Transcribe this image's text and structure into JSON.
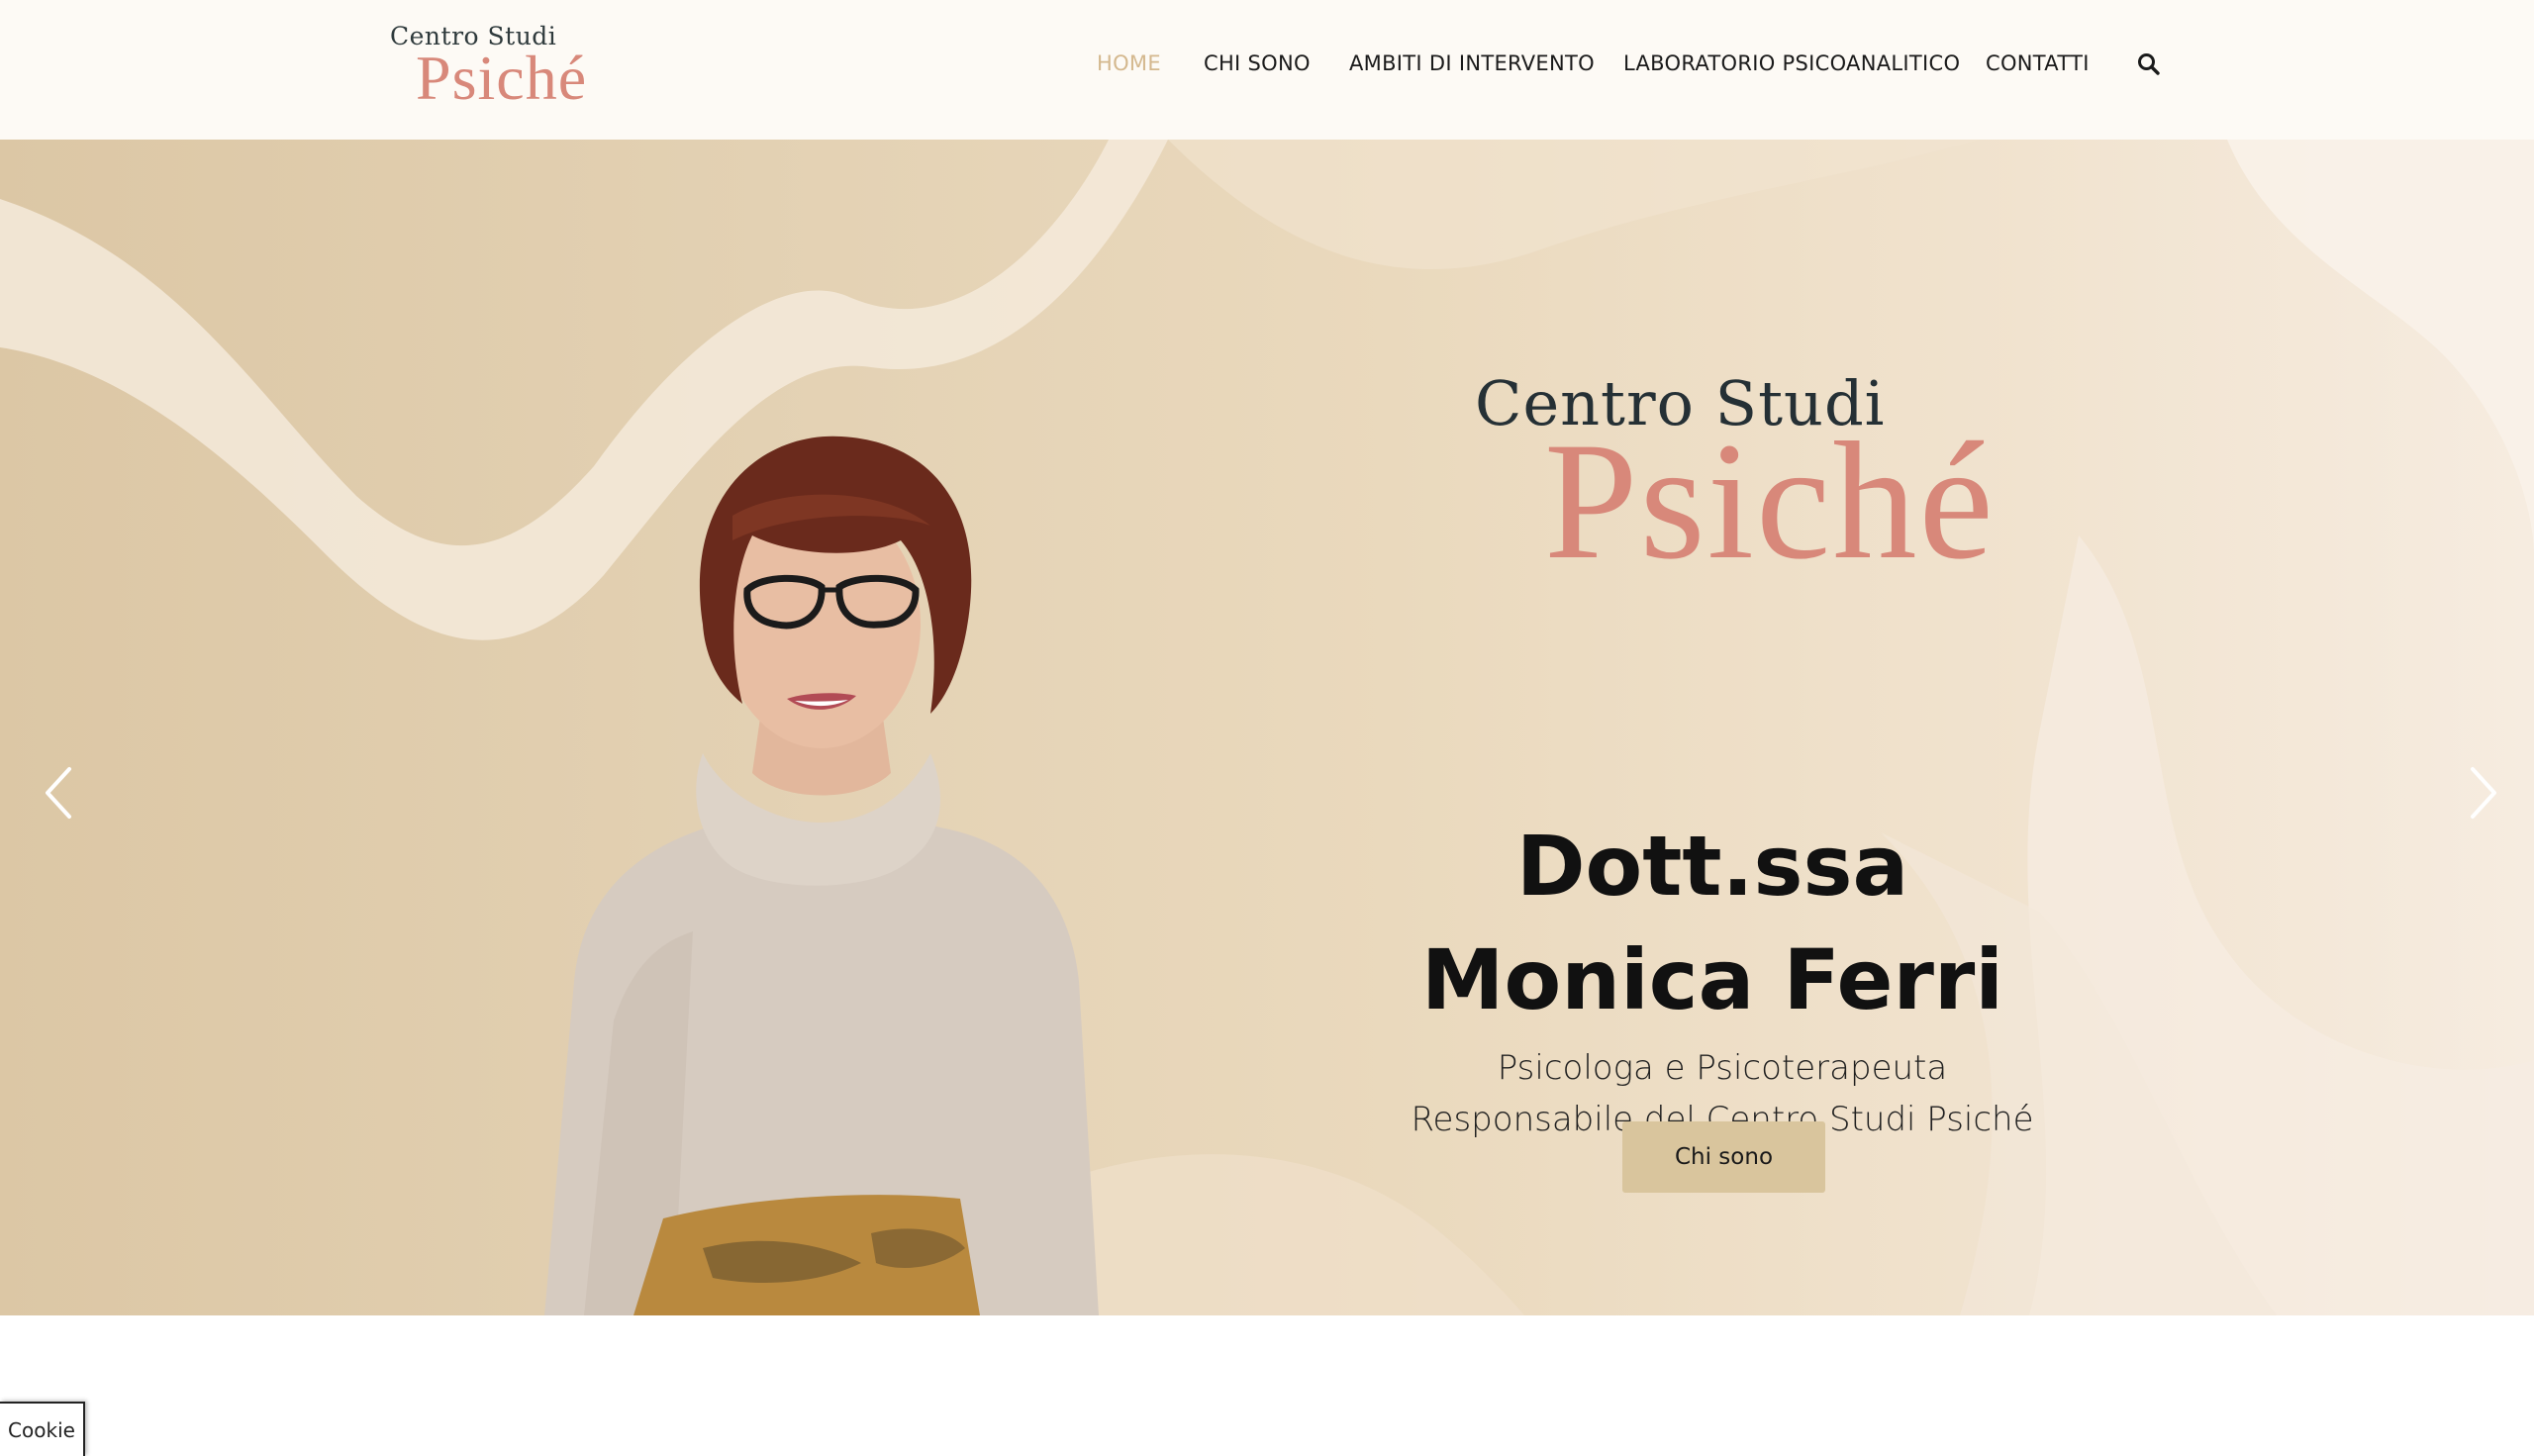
{
  "header": {
    "logo": {
      "top": "Centro Studi",
      "main": "Psiché"
    },
    "nav": [
      {
        "label": "HOME",
        "active": true
      },
      {
        "label": "CHI SONO",
        "active": false
      },
      {
        "label": "AMBITI DI INTERVENTO",
        "active": false
      },
      {
        "label": "LABORATORIO PSICOANALITICO",
        "active": false
      },
      {
        "label": "CONTATTI",
        "active": false
      }
    ],
    "search_icon": "search-icon"
  },
  "hero": {
    "brand_top": "Centro Studi",
    "brand_main": "Psiché",
    "name_line1": "Dott.ssa",
    "name_line2": "Monica Ferri",
    "role_line1": "Psicologa e Psicoterapeuta",
    "role_line2": "Responsabile del Centro Studi Psiché",
    "cta_label": "Chi sono",
    "prev_icon": "chevron-left-icon",
    "next_icon": "chevron-right-icon"
  },
  "cookie": {
    "label": "Cookie"
  },
  "colors": {
    "accent": "#d8887a",
    "nav_active": "#d4b88e",
    "button": "#d9c59d",
    "hero_bg": "#e8d6b9"
  }
}
